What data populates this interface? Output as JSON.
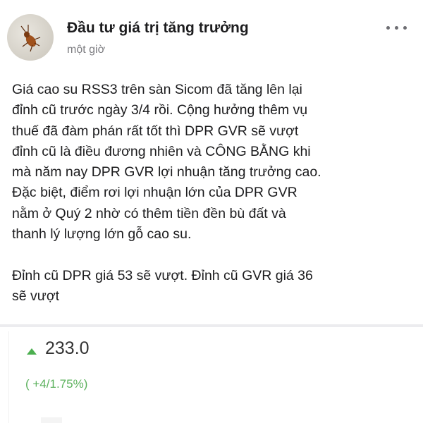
{
  "post": {
    "author": "Đầu tư giá trị tăng trưởng",
    "time": "một giờ",
    "more_icon": "more-horizontal-icon",
    "body_lines": [
      "Giá cao su RSS3 trên sàn Sicom đã tăng lên lại",
      "đỉnh cũ trước ngày 3/4 rồi. Cộng hưởng thêm vụ",
      "thuế đã đàm phán rất tốt thì DPR GVR sẽ vượt",
      "đỉnh cũ là điều đương nhiên và CÔNG BẰNG khi",
      "mà năm nay DPR GVR lợi nhuận tăng trưởng cao.",
      "Đặc biệt, điểm rơi lợi nhuận lớn của DPR GVR",
      "nằm ở Quý 2 nhờ có thêm tiền đền bù đất và",
      "thanh lý lượng lớn gỗ cao su."
    ],
    "body_lines_2": [
      "Đỉnh cũ DPR giá 53 sẽ vượt. Đỉnh cũ GVR giá 36",
      "sẽ vượt"
    ]
  },
  "stock": {
    "price": "233.0",
    "change": "( +4/1.75%)",
    "trend_icon": "triangle-up-icon",
    "up_color": "#4caf50"
  }
}
